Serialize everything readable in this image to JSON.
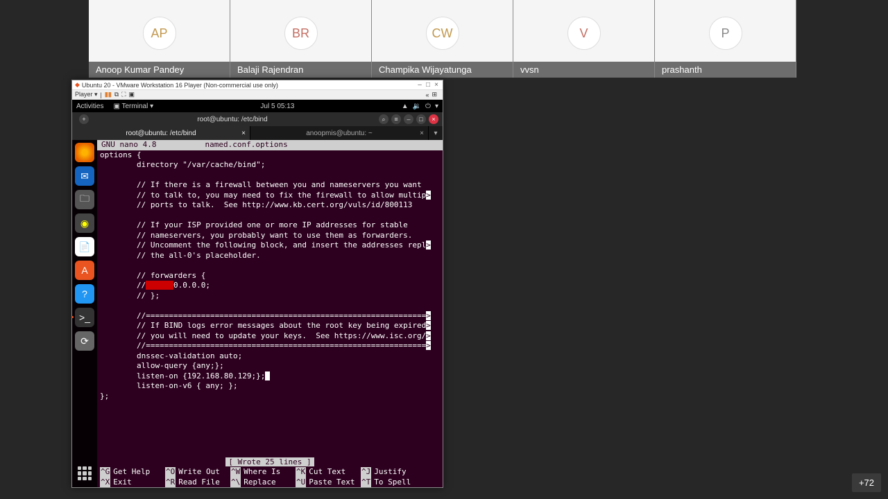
{
  "participants": [
    {
      "initials": "AP",
      "name": "Anoop Kumar Pandey"
    },
    {
      "initials": "BR",
      "name": "Balaji Rajendran"
    },
    {
      "initials": "CW",
      "name": "Champika Wijayatunga"
    },
    {
      "initials": "V",
      "name": "vvsn"
    },
    {
      "initials": "P",
      "name": "prashanth"
    }
  ],
  "overflow_count": "+72",
  "vmware": {
    "title": "Ubuntu 20 - VMware Workstation 16 Player (Non-commercial use only)",
    "player_label": "Player",
    "win_min": "–",
    "win_max": "□",
    "win_close": "×"
  },
  "gnome": {
    "activities": "Activities",
    "app": "Terminal",
    "clock": "Jul 5  05:13"
  },
  "terminal": {
    "new_tab": "+",
    "title": "root@ubuntu: /etc/bind",
    "search": "⌕",
    "menu": "≡",
    "min": "–",
    "max": "□",
    "close": "×",
    "tabs": [
      {
        "label": "root@ubuntu: /etc/bind",
        "active": true
      },
      {
        "label": "anoopmis@ubuntu: ~",
        "active": false
      }
    ],
    "tab_close": "×",
    "tab_drop": "▾"
  },
  "nano": {
    "version": "GNU nano 4.8",
    "filename": "named.conf.options",
    "status": "[ Wrote 25 lines ]",
    "lines": [
      "options {",
      "        directory \"/var/cache/bind\";",
      "",
      "        // If there is a firewall between you and nameservers you want",
      "        // to talk to, you may need to fix the firewall to allow multip",
      "        // ports to talk.  See http://www.kb.cert.org/vuls/id/800113",
      "",
      "        // If your ISP provided one or more IP addresses for stable",
      "        // nameservers, you probably want to use them as forwarders.",
      "        // Uncomment the following block, and insert the addresses repl",
      "        // the all-0's placeholder.",
      "",
      "        // forwarders {",
      "        //      0.0.0.0;",
      "        // };",
      "",
      "        //=============================================================",
      "        // If BIND logs error messages about the root key being expired",
      "        // you will need to update your keys.  See https://www.isc.org/",
      "        //=============================================================",
      "        dnssec-validation auto;",
      "        allow-query {any;};",
      "        listen-on {192.168.80.129;};",
      "        listen-on-v6 { any; };",
      "};"
    ],
    "truncated_lines": [
      4,
      9,
      16,
      17,
      18,
      19
    ],
    "red_line_idx": 13,
    "red_start": 10,
    "red_len": 6,
    "cursor_line_idx": 22,
    "footer": [
      [
        {
          "k": "^G",
          "l": "Get Help"
        },
        {
          "k": "^O",
          "l": "Write Out"
        },
        {
          "k": "^W",
          "l": "Where Is"
        },
        {
          "k": "^K",
          "l": "Cut Text"
        },
        {
          "k": "^J",
          "l": "Justify"
        }
      ],
      [
        {
          "k": "^X",
          "l": "Exit"
        },
        {
          "k": "^R",
          "l": "Read File"
        },
        {
          "k": "^\\",
          "l": "Replace"
        },
        {
          "k": "^U",
          "l": "Paste Text"
        },
        {
          "k": "^T",
          "l": "To Spell"
        }
      ]
    ]
  },
  "dock": {
    "firefox": "firefox-icon",
    "thunderbird": "thunderbird-icon",
    "files": "files-icon",
    "rhythmbox": "rhythmbox-icon",
    "writer": "writer-icon",
    "software": "software-icon",
    "help": "help-icon",
    "terminal": "terminal-icon",
    "update": "update-icon",
    "apps": "apps-icon"
  }
}
